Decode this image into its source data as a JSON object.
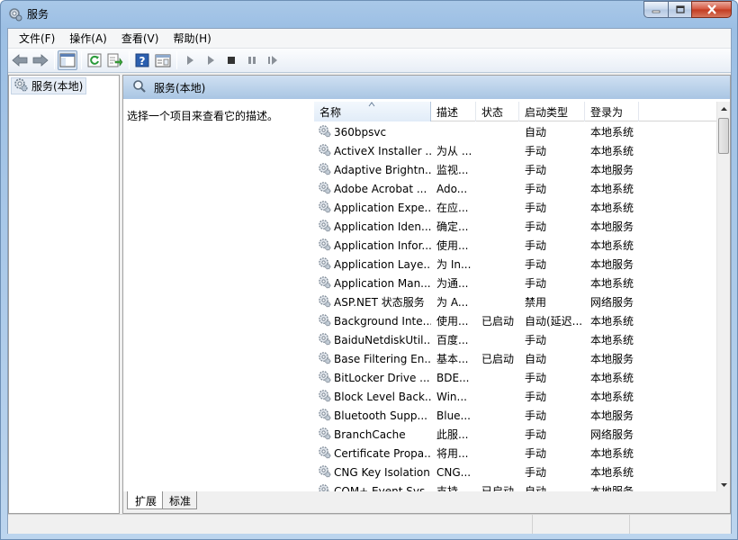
{
  "window": {
    "title": "服务"
  },
  "menu": [
    "文件(F)",
    "操作(A)",
    "查看(V)",
    "帮助(H)"
  ],
  "toolbar": [
    "back-icon",
    "forward-icon",
    "show-hide-console-tree-icon",
    "refresh-icon",
    "export-list-icon",
    "help-icon",
    "properties-icon",
    "start-icon",
    "start-alt-icon",
    "stop-icon",
    "pause-icon",
    "restart-icon"
  ],
  "tree": {
    "root_label": "服务(本地)"
  },
  "panel": {
    "header": "服务(本地)",
    "description_hint": "选择一个项目来查看它的描述。"
  },
  "columns": {
    "name": "名称",
    "desc": "描述",
    "status": "状态",
    "startup": "启动类型",
    "logon": "登录为"
  },
  "services": [
    {
      "name": "360bpsvc",
      "desc": "",
      "status": "",
      "startup": "自动",
      "logon": "本地系统"
    },
    {
      "name": "ActiveX Installer ...",
      "desc": "为从 ...",
      "status": "",
      "startup": "手动",
      "logon": "本地系统"
    },
    {
      "name": "Adaptive Brightn...",
      "desc": "监视...",
      "status": "",
      "startup": "手动",
      "logon": "本地服务"
    },
    {
      "name": "Adobe Acrobat ...",
      "desc": "Ado...",
      "status": "",
      "startup": "手动",
      "logon": "本地系统"
    },
    {
      "name": "Application Expe...",
      "desc": "在应...",
      "status": "",
      "startup": "手动",
      "logon": "本地系统"
    },
    {
      "name": "Application Iden...",
      "desc": "确定...",
      "status": "",
      "startup": "手动",
      "logon": "本地服务"
    },
    {
      "name": "Application Infor...",
      "desc": "使用...",
      "status": "",
      "startup": "手动",
      "logon": "本地系统"
    },
    {
      "name": "Application Laye...",
      "desc": "为 In...",
      "status": "",
      "startup": "手动",
      "logon": "本地服务"
    },
    {
      "name": "Application Man...",
      "desc": "为通...",
      "status": "",
      "startup": "手动",
      "logon": "本地系统"
    },
    {
      "name": "ASP.NET 状态服务",
      "desc": "为 A...",
      "status": "",
      "startup": "禁用",
      "logon": "网络服务"
    },
    {
      "name": "Background Inte...",
      "desc": "使用...",
      "status": "已启动",
      "startup": "自动(延迟...",
      "logon": "本地系统"
    },
    {
      "name": "BaiduNetdiskUtil...",
      "desc": "百度...",
      "status": "",
      "startup": "手动",
      "logon": "本地系统"
    },
    {
      "name": "Base Filtering En...",
      "desc": "基本...",
      "status": "已启动",
      "startup": "自动",
      "logon": "本地服务"
    },
    {
      "name": "BitLocker Drive ...",
      "desc": "BDE...",
      "status": "",
      "startup": "手动",
      "logon": "本地系统"
    },
    {
      "name": "Block Level Back...",
      "desc": "Win...",
      "status": "",
      "startup": "手动",
      "logon": "本地系统"
    },
    {
      "name": "Bluetooth Supp...",
      "desc": "Blue...",
      "status": "",
      "startup": "手动",
      "logon": "本地服务"
    },
    {
      "name": "BranchCache",
      "desc": "此服...",
      "status": "",
      "startup": "手动",
      "logon": "网络服务"
    },
    {
      "name": "Certificate Propa...",
      "desc": "将用...",
      "status": "",
      "startup": "手动",
      "logon": "本地系统"
    },
    {
      "name": "CNG Key Isolation",
      "desc": "CNG...",
      "status": "",
      "startup": "手动",
      "logon": "本地系统"
    },
    {
      "name": "COM+ Event Sys...",
      "desc": "支持...",
      "status": "已启动",
      "startup": "自动",
      "logon": "本地服务"
    }
  ],
  "tabs": [
    "扩展",
    "标准"
  ],
  "colors": {
    "accent": "#a9c5e3",
    "selection": "#e6edf6",
    "close_button": "#d4543c"
  }
}
